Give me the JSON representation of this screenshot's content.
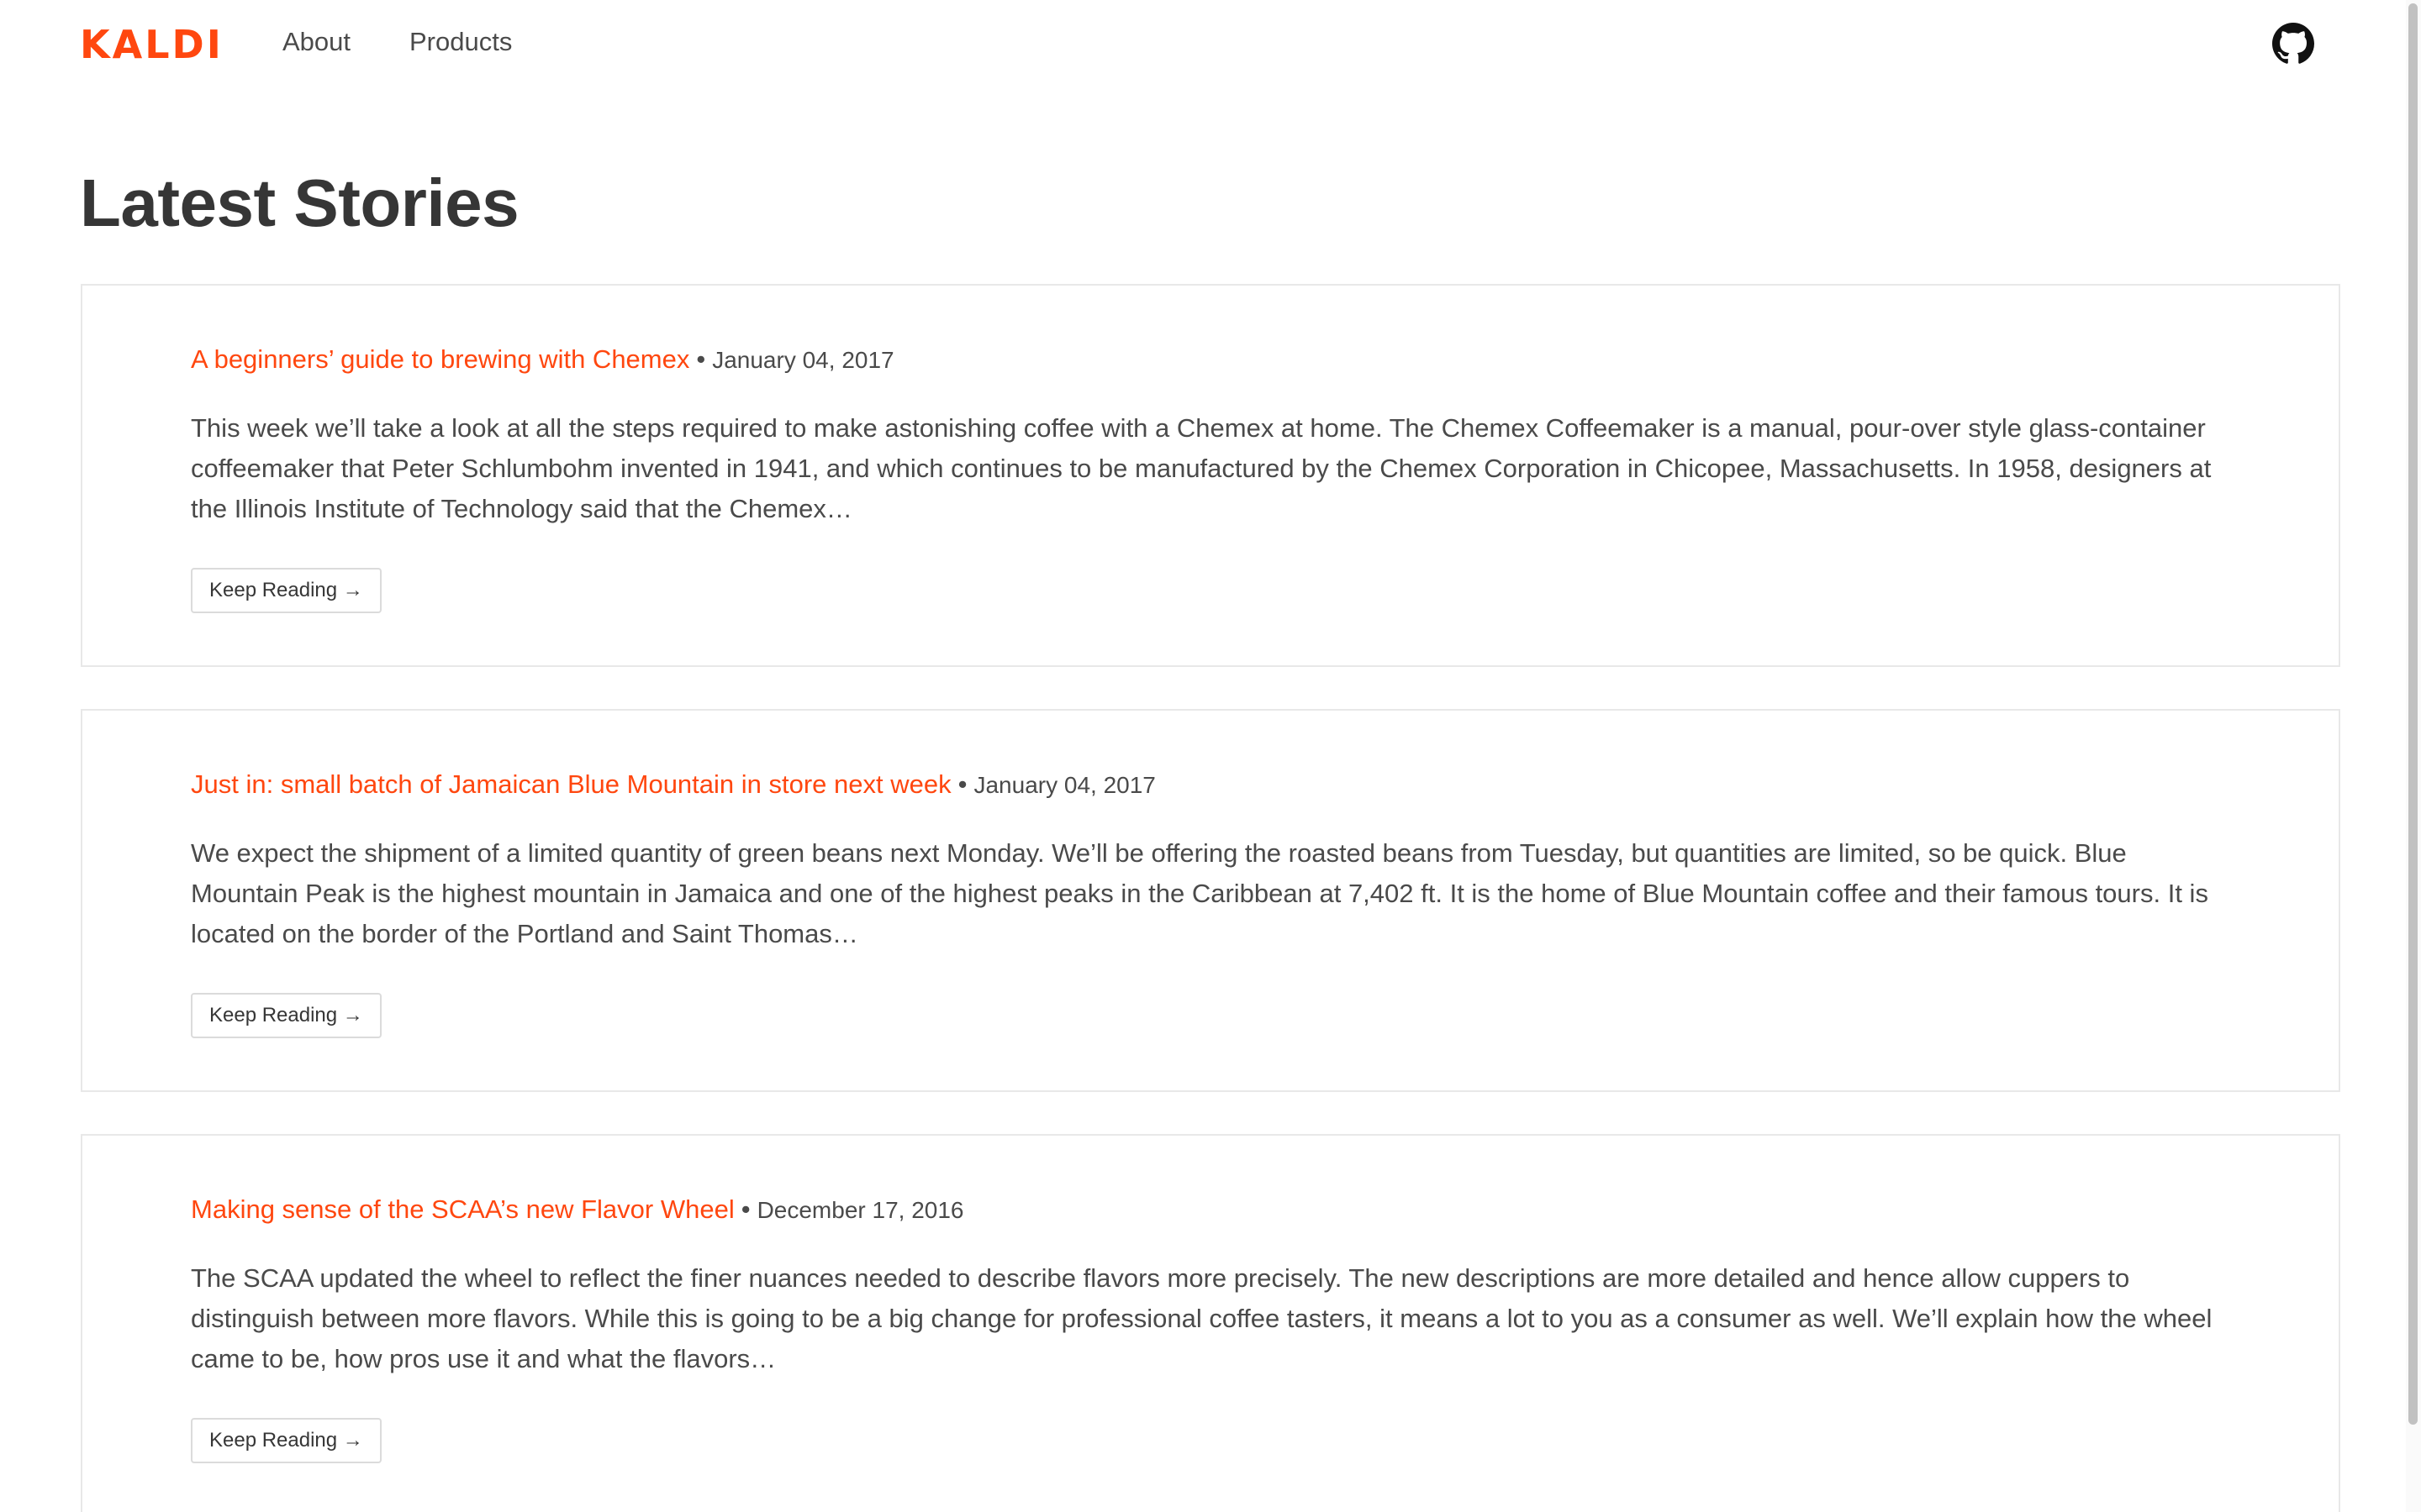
{
  "header": {
    "logo": "KALDI",
    "nav": [
      {
        "label": "About"
      },
      {
        "label": "Products"
      }
    ],
    "github_icon": "github-icon"
  },
  "main": {
    "title": "Latest Stories",
    "stories": [
      {
        "title": "A beginners’ guide to brewing with Chemex",
        "separator": "•",
        "date": "January 04, 2017",
        "excerpt": "This week we’ll take a look at all the steps required to make astonishing coffee with a Chemex at home. The Chemex Coffeemaker is a manual, pour-over style glass-container coffeemaker that Peter Schlumbohm invented in 1941, and which continues to be manufactured by the Chemex Corporation in Chicopee, Massachusetts. In 1958, designers at the Illinois Institute of Technology said that the Chemex…",
        "button": "Keep Reading →"
      },
      {
        "title": "Just in: small batch of Jamaican Blue Mountain in store next week",
        "separator": "•",
        "date": "January 04, 2017",
        "excerpt": "We expect the shipment of a limited quantity of green beans next Monday. We’ll be offering the roasted beans from Tuesday, but quantities are limited, so be quick. Blue Mountain Peak is the highest mountain in Jamaica and one of the highest peaks in the Caribbean at 7,402 ft. It is the home of Blue Mountain coffee and their famous tours. It is located on the border of the Portland and Saint Thomas…",
        "button": "Keep Reading →"
      },
      {
        "title": "Making sense of the SCAA’s new Flavor Wheel",
        "separator": "•",
        "date": "December 17, 2016",
        "excerpt": "The SCAA updated the wheel to reflect the finer nuances needed to describe flavors more precisely. The new descriptions are more detailed and hence allow cuppers to distinguish between more flavors. While this is going to be a big change for professional coffee tasters, it means a lot to you as a consumer as well. We’ll explain how the wheel came to be, how pros use it and what the flavors…",
        "button": "Keep Reading →"
      }
    ]
  },
  "colors": {
    "brand": "#ff470f",
    "text": "#4a4a4a",
    "heading": "#363636",
    "border": "#e8e8e8"
  }
}
